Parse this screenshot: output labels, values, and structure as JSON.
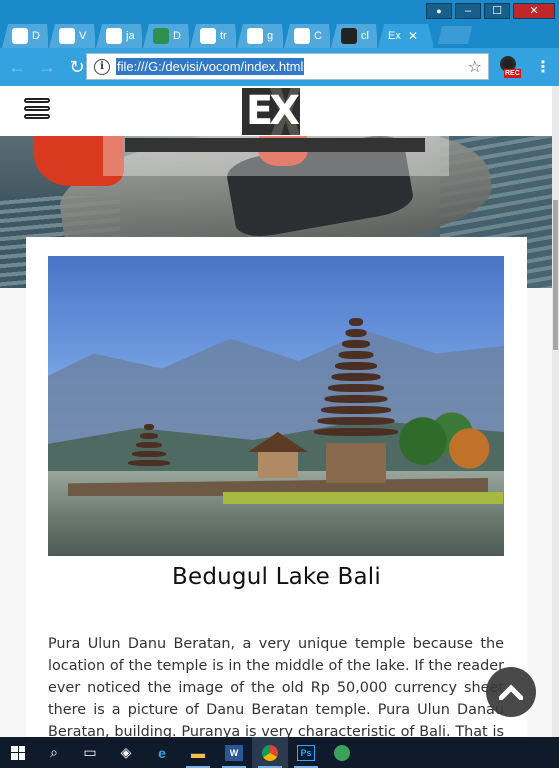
{
  "browser": {
    "tabs": [
      {
        "title": "D",
        "favicon": "v-logo-icon",
        "favcolor": "#ffffff"
      },
      {
        "title": "V",
        "favicon": "v-logo-icon",
        "favcolor": "#ffffff"
      },
      {
        "title": "ja",
        "favicon": "google-icon",
        "favcolor": "#ffffff"
      },
      {
        "title": "D",
        "favicon": "drive-icon",
        "favcolor": "#2f8f4e"
      },
      {
        "title": "tr",
        "favicon": "google-icon",
        "favcolor": "#ffffff"
      },
      {
        "title": "g",
        "favicon": "google-icon",
        "favcolor": "#ffffff"
      },
      {
        "title": "C",
        "favicon": "x-cross-icon",
        "favcolor": "#ffffff"
      },
      {
        "title": "cl",
        "favicon": "color-wheel-icon",
        "favcolor": "#222222"
      },
      {
        "title": "Ex",
        "favicon": "none",
        "favcolor": "#35a2e0",
        "active": true
      }
    ],
    "close_tab_glyph": "✕",
    "url": "file:///G:/devisi/vocom/index.html",
    "back_glyph": "←",
    "forward_glyph": "→",
    "reload_glyph": "↻",
    "info_glyph": "i",
    "star_glyph": "☆",
    "rec_label": "REC",
    "menu_glyph": "⋮",
    "win_min": "–",
    "win_max": "☐",
    "win_close": "✕",
    "win_user": "👤"
  },
  "site": {
    "logo_text": "EX",
    "article": {
      "title": "Bedugul Lake Bali",
      "body": "Pura Ulun Danu Beratan, a very unique temple because the location of the temple is in the middle of the lake. If the reader ever noticed the image of the old Rp 50,000 currency sheet there is a picture of Danu Beratan temple. Pura Ulun Danau Beratan, building. Puranya is very characteristic of Bali. That is a"
    },
    "scroll_top_glyph": "⌃"
  },
  "taskbar": {
    "word_label": "W",
    "ps_label": "Ps"
  },
  "colors": {
    "chrome_blue": "#35a2e0",
    "taskbar": "#0f1a2a",
    "card": "#ffffff"
  }
}
